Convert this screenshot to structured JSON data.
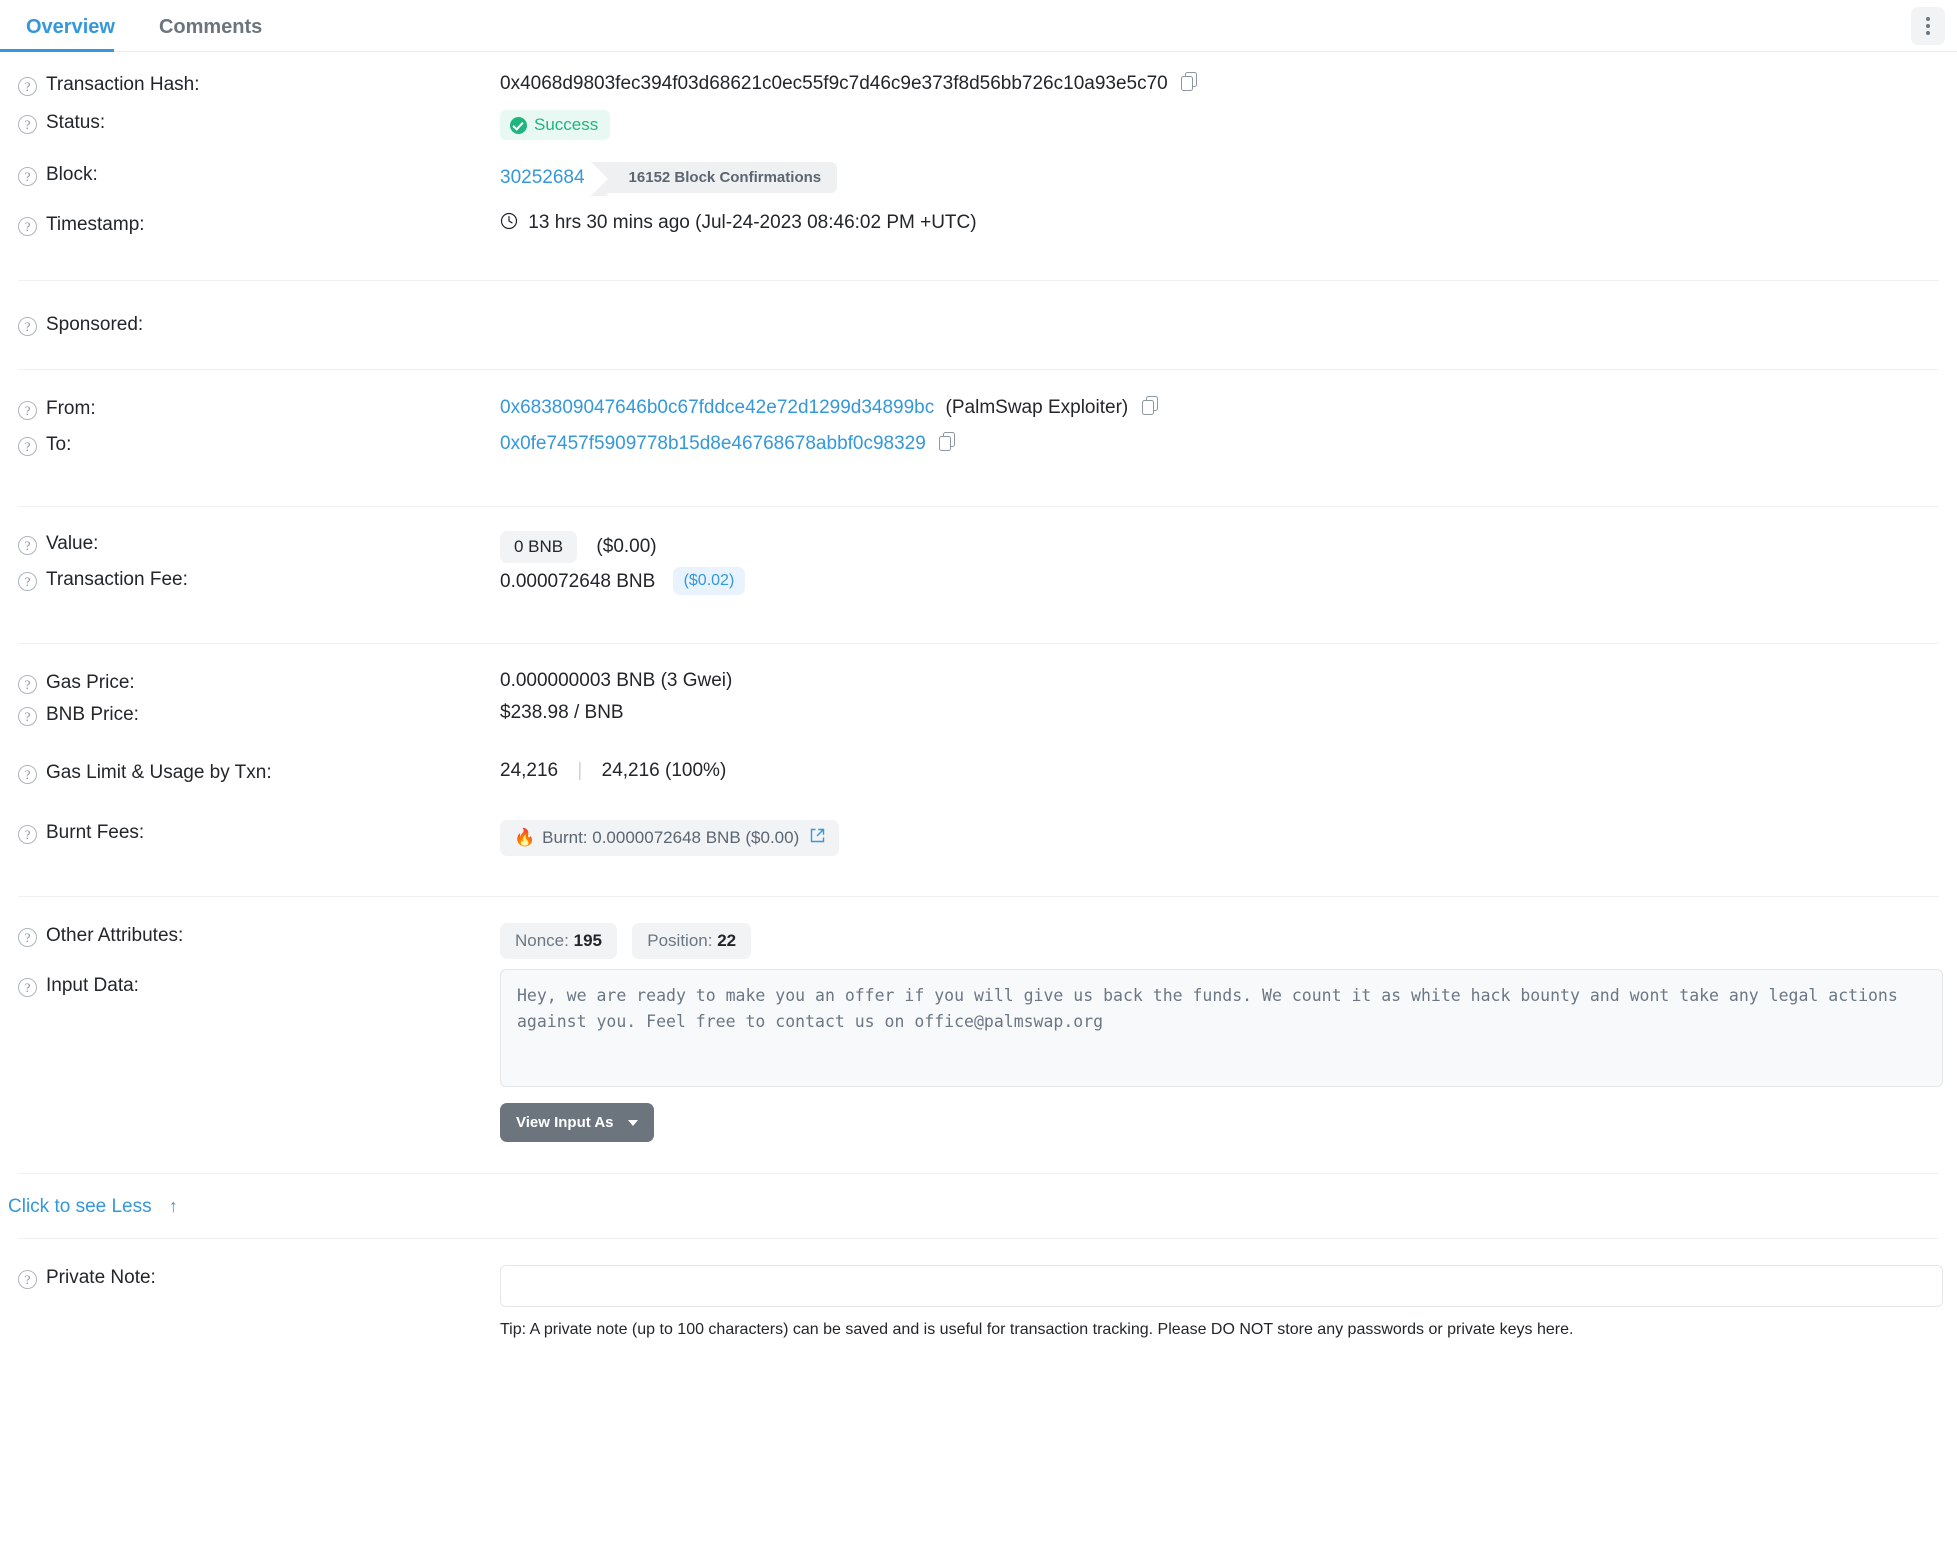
{
  "tabs": [
    {
      "label": "Overview",
      "active": true
    },
    {
      "label": "Comments",
      "active": false
    }
  ],
  "menu": {
    "icon": "kebab-menu-icon"
  },
  "rows": {
    "transaction_hash": {
      "label": "Transaction Hash:",
      "value": "0x4068d9803fec394f03d68621c0ec55f9c7d46c9e373f8d56bb726c10a93e5c70"
    },
    "status": {
      "label": "Status:",
      "value": "Success"
    },
    "block": {
      "label": "Block:",
      "number": "30252684",
      "confirmations": "16152 Block Confirmations"
    },
    "timestamp": {
      "label": "Timestamp:",
      "value": "13 hrs 30 mins ago (Jul-24-2023 08:46:02 PM +UTC)"
    },
    "sponsored": {
      "label": "Sponsored:",
      "value": ""
    },
    "from": {
      "label": "From:",
      "address": "0x683809047646b0c67fddce42e72d1299d34899bc",
      "tag": "(PalmSwap Exploiter)"
    },
    "to": {
      "label": "To:",
      "address": "0x0fe7457f5909778b15d8e46768678abbf0c98329"
    },
    "value": {
      "label": "Value:",
      "amount": "0 BNB",
      "usd": "($0.00)"
    },
    "transaction_fee": {
      "label": "Transaction Fee:",
      "amount": "0.000072648 BNB",
      "usd": "($0.02)"
    },
    "gas_price": {
      "label": "Gas Price:",
      "value": "0.000000003 BNB (3 Gwei)"
    },
    "bnb_price": {
      "label": "BNB Price:",
      "value": "$238.98 / BNB"
    },
    "gas_limit": {
      "label": "Gas Limit & Usage by Txn:",
      "limit": "24,216",
      "usage": "24,216 (100%)"
    },
    "burnt_fees": {
      "label": "Burnt Fees:",
      "value": "Burnt: 0.0000072648 BNB ($0.00)",
      "flame": "🔥"
    },
    "other_attributes": {
      "label": "Other Attributes:",
      "nonce_label": "Nonce:",
      "nonce_value": "195",
      "position_label": "Position:",
      "position_value": "22"
    },
    "input_data": {
      "label": "Input Data:",
      "text": "Hey, we are ready to make you an offer if you will give us back the funds. We count it as white hack bounty and wont take any legal actions against you. Feel free to contact us on office@palmswap.org",
      "button_label": "View Input As"
    },
    "private_note": {
      "label": "Private Note:",
      "value": "",
      "tip": "Tip: A private note (up to 100 characters) can be saved and is useful for transaction tracking. Please DO NOT store any passwords or private keys here."
    }
  },
  "see_less": {
    "label": "Click to see Less",
    "arrow": "↑"
  },
  "colors": {
    "accent": "#3498db",
    "success": "#21b57e",
    "success_bg": "#e8f8f2",
    "muted": "#6b7785",
    "button": "#6c757d"
  }
}
